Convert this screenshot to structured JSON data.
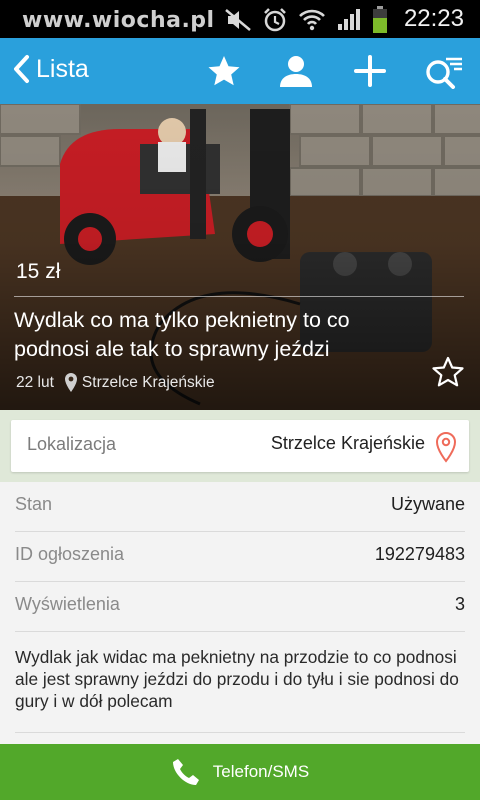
{
  "status_bar": {
    "watermark": "www.wiocha.pl",
    "time": "22:23",
    "icons": [
      "image-icon",
      "mute-icon",
      "alarm-icon",
      "wifi-icon",
      "signal-icon",
      "battery-icon"
    ]
  },
  "app_bar": {
    "back_label": "Lista",
    "actions": [
      "star-icon",
      "person-icon",
      "plus-icon",
      "search-filter-icon"
    ],
    "color": "#2aa0dc"
  },
  "ad": {
    "price": "15 zł",
    "title": "Wydlak co ma tylko peknietny to co podnosi ale tak to sprawny jeździ",
    "date": "22 lut",
    "location": "Strzelce Krajeńskie"
  },
  "location_card": {
    "label": "Lokalizacja",
    "value": "Strzelce Krajeńskie"
  },
  "details": [
    {
      "key": "Stan",
      "value": "Używane"
    },
    {
      "key": "ID ogłoszenia",
      "value": "192279483"
    },
    {
      "key": "Wyświetlenia",
      "value": "3"
    }
  ],
  "description": "Wydlak jak widac ma peknietny na przodzie to co podnosi ale jest sprawny jeździ do przodu i do tyłu i sie podnosi do gury i w dół polecam",
  "call_button": {
    "label": "Telefon/SMS",
    "color": "#52a82a"
  }
}
